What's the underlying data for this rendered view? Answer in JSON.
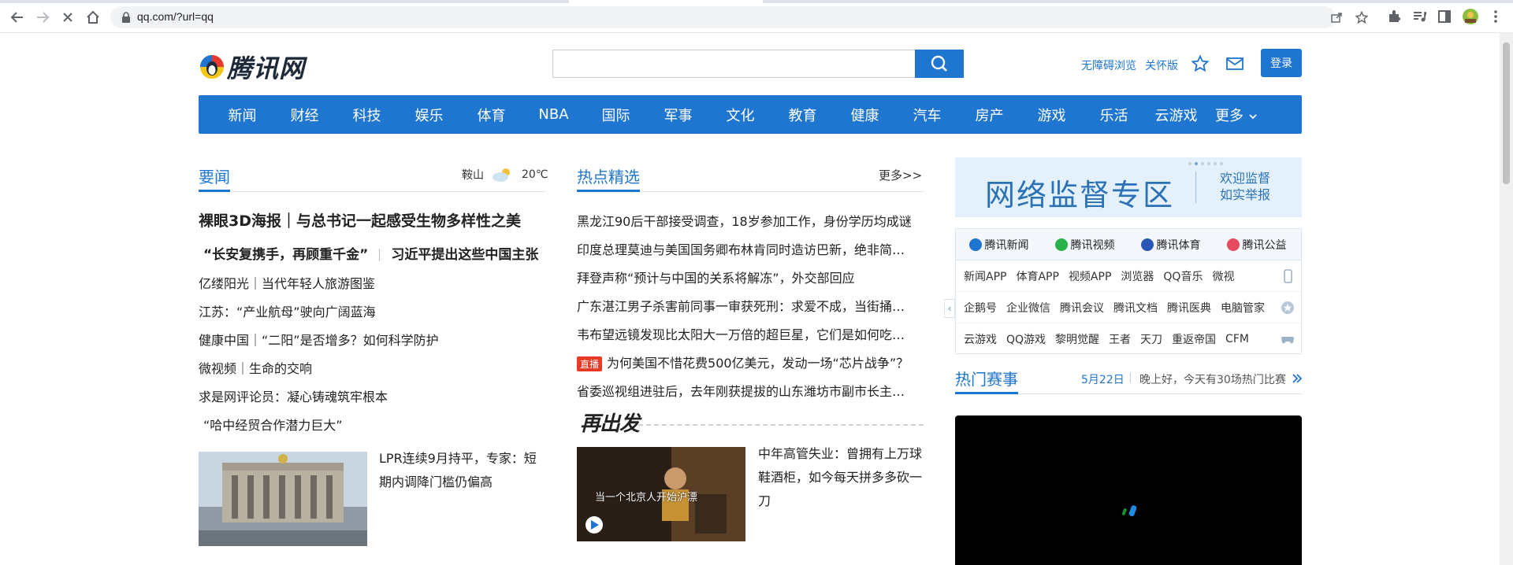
{
  "browser": {
    "url": "qq.com/?url=qq"
  },
  "header": {
    "logo_text": "腾讯网",
    "search_placeholder": "",
    "links": [
      "无障碍浏览",
      "关怀版"
    ],
    "login_label": "登录"
  },
  "channels": [
    "新闻",
    "财经",
    "科技",
    "娱乐",
    "体育",
    "NBA",
    "国际",
    "军事",
    "文化",
    "教育",
    "健康",
    "汽车",
    "房产",
    "游戏",
    "乐活",
    "云游戏"
  ],
  "channels_more": "更多",
  "col1": {
    "title": "要闻",
    "weather_city": "鞍山",
    "weather_temp": "20℃",
    "headline": "裸眼3D海报｜与总书记一起感受生物多样性之美",
    "sub_left": "“长安复携手，再顾重千金”",
    "sub_right": "习近平提出这些中国主张",
    "items": [
      "亿缕阳光｜当代年轻人旅游图鉴",
      "江苏：“产业航母”驶向广阔蓝海",
      "健康中国｜“二阳”是否增多？如何科学防护",
      "微视频｜生命的交响",
      "求是网评论员：凝心铸魂筑牢根本",
      "“哈中经贸合作潜力巨大”"
    ],
    "feature_caption": "LPR连续9月持平，专家：短期内调降门槛仍偏高"
  },
  "col2": {
    "title": "热点精选",
    "more": "更多>>",
    "items": [
      "黑龙江90后干部接受调查，18岁参加工作，身份学历均成谜",
      "印度总理莫迪与美国国务卿布林肯同时造访巴新，绝非简单的...",
      "拜登声称“预计与中国的关系将解冻”，外交部回应",
      "广东湛江男子杀害前同事一审获死刑：求爱不成，当街捅被害...",
      "韦布望远镜发现比太阳大一万倍的超巨星，它们是如何吃这么...",
      "为何美国不惜花费500亿美元，发动一场“芯片战争”？",
      "省委巡视组进驻后，去年刚获提拔的山东潍坊市副市长主动投案..."
    ],
    "live_badge": "直播",
    "program_logo": "再出发",
    "video_overlay_text": "当一个北京人开始沪漂",
    "video_caption": "中年高管失业：曾拥有上万球鞋酒柜，如今每天拼多多砍一刀"
  },
  "col3": {
    "banner_big": "网络监督专区",
    "banner_small": [
      "欢迎监督",
      "如实举报"
    ],
    "tabs": [
      {
        "label": "腾讯新闻",
        "color": "#1f76d1"
      },
      {
        "label": "腾讯视频",
        "color": "#28b34a"
      },
      {
        "label": "腾讯体育",
        "color": "#2a57b6"
      },
      {
        "label": "腾讯公益",
        "color": "#e84a5f"
      }
    ],
    "rows": [
      [
        "新闻APP",
        "体育APP",
        "视频APP",
        "浏览器",
        "QQ音乐",
        "微视"
      ],
      [
        "企鹅号",
        "企业微信",
        "腾讯会议",
        "腾讯文档",
        "腾讯医典",
        "电脑管家"
      ],
      [
        "云游戏",
        "QQ游戏",
        "黎明觉醒",
        "王者",
        "天刀",
        "重返帝国",
        "CFM"
      ]
    ],
    "sports_title": "热门赛事",
    "sports_date": "5月22日",
    "sports_msg": "晚上好，今天有30场热门比赛"
  }
}
